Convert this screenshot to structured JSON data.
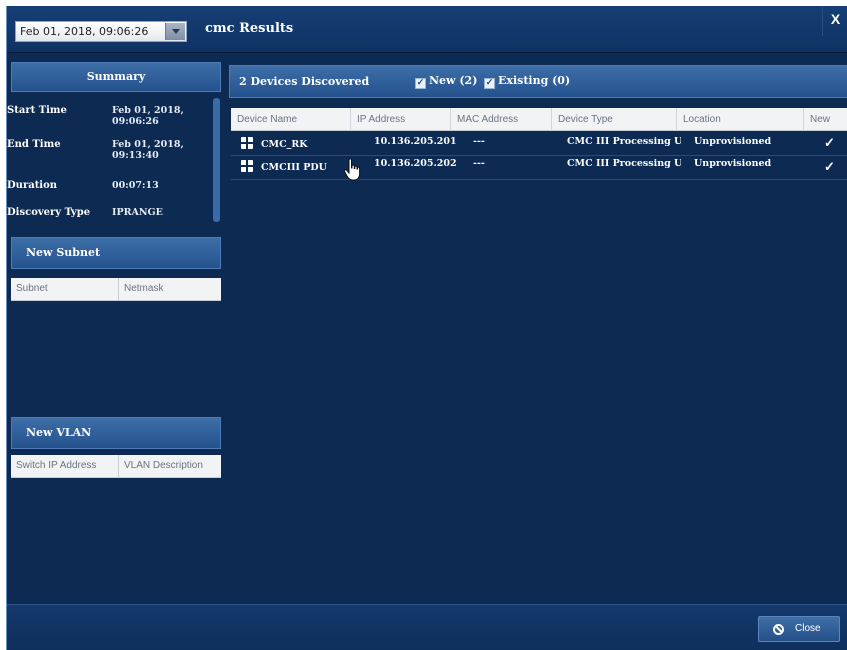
{
  "window": {
    "title": "cmc Results",
    "close_label": "X",
    "date_select": {
      "value": "Feb 01, 2018, 09:06:26"
    }
  },
  "summary": {
    "header": "Summary",
    "rows": [
      {
        "key": "Start Time",
        "value": "Feb 01, 2018, 09:06:26"
      },
      {
        "key": "End Time",
        "value": "Feb 01, 2018, 09:13:40"
      },
      {
        "key": "Duration",
        "value": "00:07:13"
      },
      {
        "key": "Discovery Type",
        "value": "IPRANGE"
      }
    ]
  },
  "subnet": {
    "header": "New Subnet",
    "columns": [
      "Subnet",
      "Netmask"
    ]
  },
  "vlan": {
    "header": "New VLAN",
    "columns": [
      "Switch IP Address",
      "VLAN Description"
    ]
  },
  "devices": {
    "header": "2 Devices Discovered",
    "filters": {
      "new_label": "New (2)",
      "existing_label": "Existing (0)"
    },
    "columns": [
      "Device Name",
      "IP Address",
      "MAC Address",
      "Device Type",
      "Location",
      "New"
    ],
    "rows": [
      {
        "name": "CMC_RK",
        "ip": "10.136.205.201",
        "mac": "---",
        "type": "CMC III Processing U...",
        "location": "Unprovisioned",
        "new": "✓"
      },
      {
        "name": "CMCIII PDU",
        "ip": "10.136.205.202",
        "mac": "---",
        "type": "CMC III Processing U...",
        "location": "Unprovisioned",
        "new": "✓"
      }
    ]
  },
  "footer": {
    "close_button": "Close"
  },
  "icons": {
    "dropdown": "chevron-down-icon",
    "device": "device-plus-icon",
    "checkbox": "check-icon",
    "close": "ban-icon",
    "cursor": "hand-pointer-icon"
  },
  "colors": {
    "background": "#0c2a52",
    "panel_header": "#2f60a0",
    "table_header": "#f2f3f5"
  }
}
